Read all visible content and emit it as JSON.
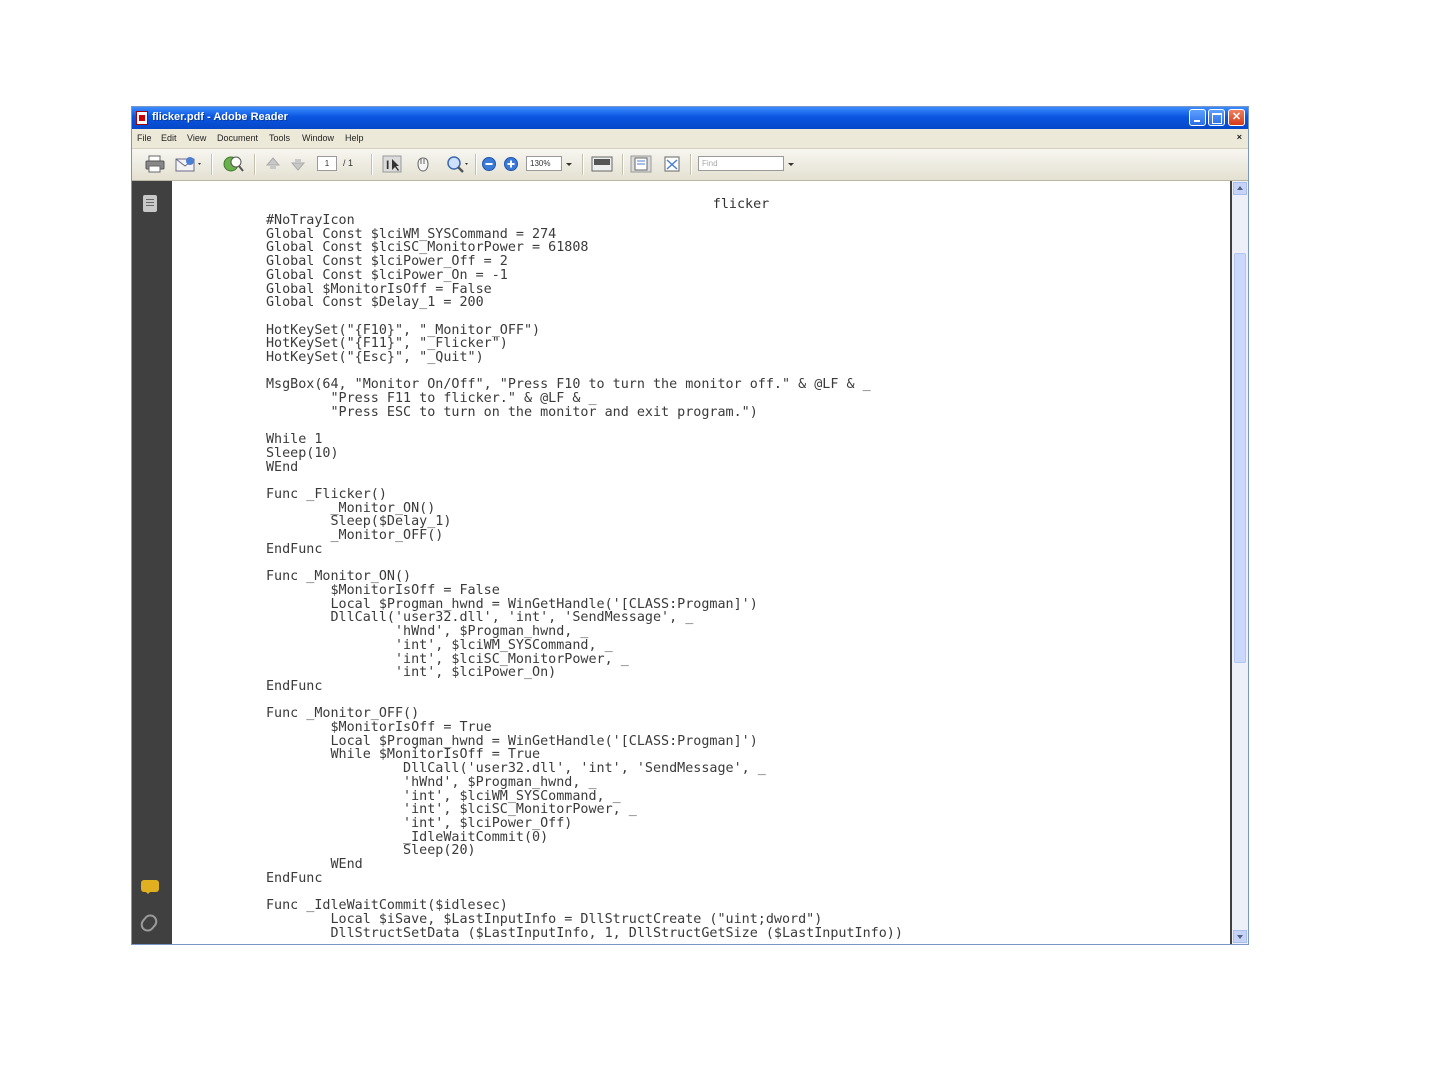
{
  "window": {
    "title": "flicker.pdf - Adobe Reader"
  },
  "menu": {
    "items": [
      "File",
      "Edit",
      "View",
      "Document",
      "Tools",
      "Window",
      "Help"
    ],
    "close_glyph": "×"
  },
  "toolbar": {
    "page_current": "1",
    "page_total": "/ 1",
    "zoom": "130%",
    "find_placeholder": "Find",
    "icons": [
      "print-icon",
      "email-icon",
      "search-globe-icon",
      "previous-page-icon",
      "next-page-icon",
      "select-tool-icon",
      "hand-tool-icon",
      "zoom-tool-icon",
      "zoom-out-icon",
      "zoom-in-icon",
      "fit-page-icon",
      "single-page-icon",
      "full-screen-icon"
    ]
  },
  "nav": {
    "icons": [
      "pages-icon",
      "comments-icon",
      "attachments-icon"
    ]
  },
  "document": {
    "title": "flicker",
    "code": "#NoTrayIcon\nGlobal Const $lciWM_SYSCommand = 274\nGlobal Const $lciSC_MonitorPower = 61808\nGlobal Const $lciPower_Off = 2\nGlobal Const $lciPower_On = -1\nGlobal $MonitorIsOff = False\nGlobal Const $Delay_1 = 200\n\nHotKeySet(\"{F10}\", \"_Monitor_OFF\")\nHotKeySet(\"{F11}\", \"_Flicker\")\nHotKeySet(\"{Esc}\", \"_Quit\")\n\nMsgBox(64, \"Monitor On/Off\", \"Press F10 to turn the monitor off.\" & @LF & _\n        \"Press F11 to flicker.\" & @LF & _\n        \"Press ESC to turn on the monitor and exit program.\")\n\nWhile 1\nSleep(10)\nWEnd\n\nFunc _Flicker()\n        _Monitor_ON()\n        Sleep($Delay_1)\n        _Monitor_OFF()\nEndFunc\n\nFunc _Monitor_ON()\n        $MonitorIsOff = False\n        Local $Progman_hwnd = WinGetHandle('[CLASS:Progman]')\n        DllCall('user32.dll', 'int', 'SendMessage', _\n                'hWnd', $Progman_hwnd, _\n                'int', $lciWM_SYSCommand, _\n                'int', $lciSC_MonitorPower, _\n                'int', $lciPower_On)\nEndFunc\n\nFunc _Monitor_OFF()\n        $MonitorIsOff = True\n        Local $Progman_hwnd = WinGetHandle('[CLASS:Progman]')\n        While $MonitorIsOff = True\n                 DllCall('user32.dll', 'int', 'SendMessage', _\n                 'hWnd', $Progman_hwnd, _\n                 'int', $lciWM_SYSCommand, _\n                 'int', $lciSC_MonitorPower, _\n                 'int', $lciPower_Off)\n                 _IdleWaitCommit(0)\n                 Sleep(20)\n        WEnd\nEndFunc\n\nFunc _IdleWaitCommit($idlesec)\n        Local $iSave, $LastInputInfo = DllStructCreate (\"uint;dword\")\n        DllStructSetData ($LastInputInfo, 1, DllStructGetSize ($LastInputInfo))"
  },
  "colors": {
    "titlebar": "#0a55e0",
    "menubar": "#ece9d8",
    "navpane": "#404040",
    "scrollbar": "#c9d8fb"
  }
}
